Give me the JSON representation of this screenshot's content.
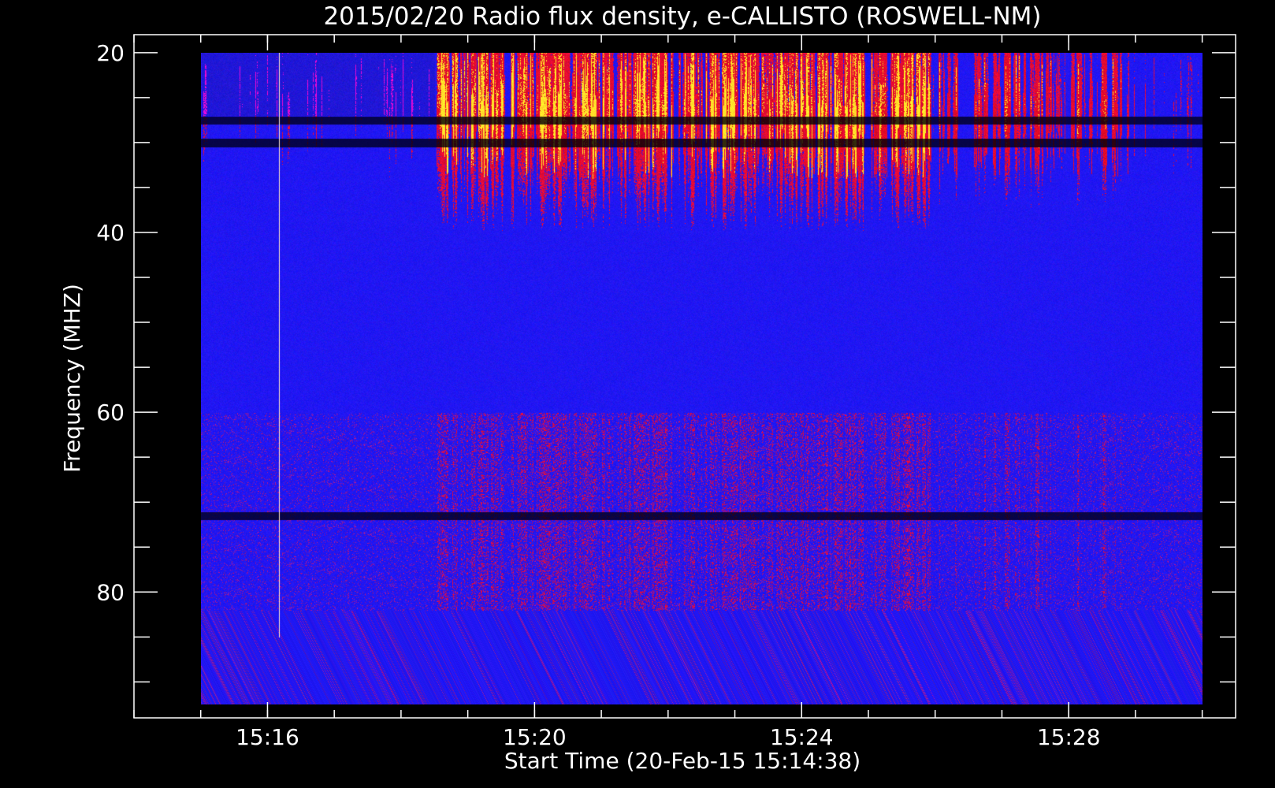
{
  "chart_data": {
    "type": "heatmap",
    "title": "2015/02/20  Radio flux density, e-CALLISTO (ROSWELL-NM)",
    "xlabel": "Start Time (20-Feb-15 15:14:38)",
    "ylabel": "Frequency (MHZ)",
    "x_axis": {
      "unit": "time",
      "min": "15:14:00",
      "max": "15:30:30",
      "data_start": "15:15:00",
      "data_end": "15:30:00",
      "major_ticks": [
        "15:16",
        "15:20",
        "15:24",
        "15:28"
      ],
      "minor_tick_interval_min": 1
    },
    "y_axis": {
      "unit": "MHz",
      "min": 18,
      "max": 94,
      "data_min": 20,
      "data_max": 92.5,
      "inverted": true,
      "major_ticks": [
        20,
        40,
        60,
        80
      ],
      "minor_tick_interval": 5
    },
    "grid": false,
    "colors": {
      "background": "#000000",
      "low": "#1010ff",
      "mid": "#d01010",
      "high": "#ffd23a",
      "axes": "#ffffff"
    },
    "features": [
      {
        "type": "bursts",
        "t_start": "15:18:30",
        "t_end": "15:26:00",
        "f_low": 20,
        "f_high": 45,
        "peak": "15:25:00"
      },
      {
        "type": "spike",
        "time": "15:16:10",
        "f_low": 20,
        "f_high": 85
      },
      {
        "type": "band",
        "f": 27.5
      },
      {
        "type": "band",
        "f": 30
      },
      {
        "type": "band",
        "f": 71.5
      }
    ]
  }
}
